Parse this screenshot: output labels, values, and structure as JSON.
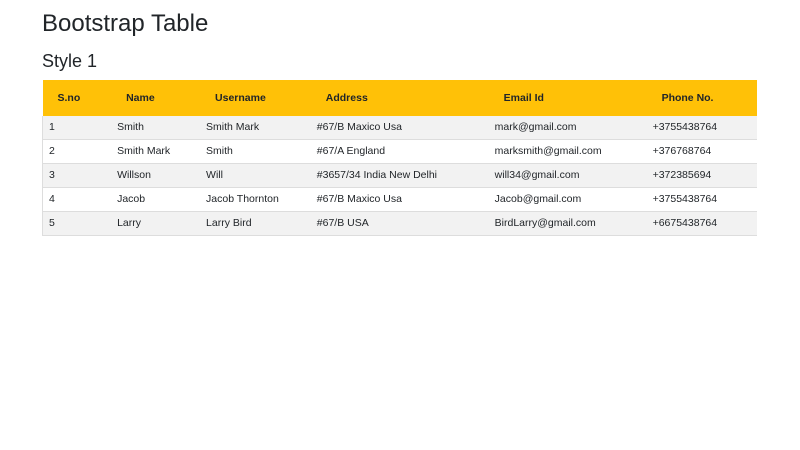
{
  "page": {
    "title": "Bootstrap Table",
    "subtitle": "Style 1"
  },
  "colors": {
    "header_bg": "#ffc107",
    "header_text": "#212529",
    "stripe_row_bg": "#f2f2f2",
    "row_border": "#dddddd",
    "body_text": "#212529"
  },
  "table": {
    "columns": [
      "S.no",
      "Name",
      "Username",
      "Address",
      "Email Id",
      "Phone No."
    ],
    "rows": [
      [
        "1",
        "Smith",
        "Smith Mark",
        "#67/B Maxico Usa",
        "mark@gmail.com",
        "+3755438764"
      ],
      [
        "2",
        "Smith Mark",
        "Smith",
        "#67/A England",
        "marksmith@gmail.com",
        "+376768764"
      ],
      [
        "3",
        "Willson",
        "Will",
        "#3657/34 India New Delhi",
        "will34@gmail.com",
        "+372385694"
      ],
      [
        "4",
        "Jacob",
        "Jacob Thornton",
        "#67/B Maxico Usa",
        "Jacob@gmail.com",
        "+3755438764"
      ],
      [
        "5",
        "Larry",
        "Larry Bird",
        "#67/B USA",
        "BirdLarry@gmail.com",
        "+6675438764"
      ]
    ]
  }
}
